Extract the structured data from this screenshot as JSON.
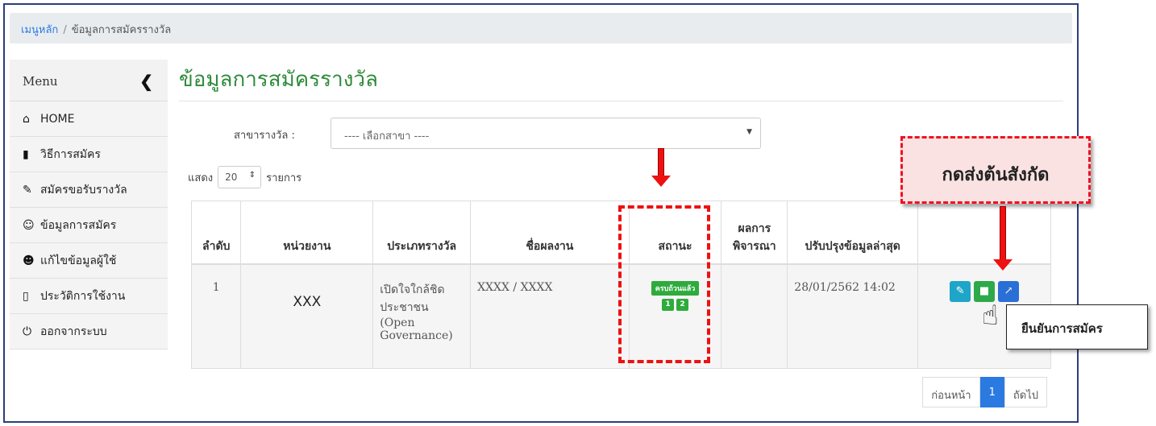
{
  "breadcrumb": {
    "home": "เมนูหลัก",
    "separator": "/",
    "current": "ข้อมูลการสมัครรางวัล"
  },
  "sidebar": {
    "title": "Menu",
    "collapse_icon": "chevron-left-icon",
    "items": [
      {
        "label": "HOME",
        "icon": "home-icon"
      },
      {
        "label": "วิธีการสมัคร",
        "icon": "file-icon"
      },
      {
        "label": "สมัครขอรับรางวัล",
        "icon": "pencil-icon"
      },
      {
        "label": "ข้อมูลการสมัคร",
        "icon": "users-icon"
      },
      {
        "label": "แก้ไขข้อมูลผู้ใช้",
        "icon": "user-icon"
      },
      {
        "label": "ประวัติการใช้งาน",
        "icon": "bookmark-icon"
      },
      {
        "label": "ออกจากระบบ",
        "icon": "power-icon"
      }
    ]
  },
  "page": {
    "title": "ข้อมูลการสมัครรางวัล"
  },
  "filter": {
    "label": "สาขารางวัล :",
    "selected": "---- เลือกสาขา ----"
  },
  "pagesize": {
    "prefix": "แสดง",
    "value": "20",
    "suffix": "รายการ"
  },
  "table": {
    "headers": [
      "ลำดับ",
      "หน่วยงาน",
      "ประเภทรางวัล",
      "ชื่อผลงาน",
      "สถานะ",
      "ผลการพิจารณา",
      "ปรับปรุงข้อมูลล่าสุด",
      ""
    ],
    "rows": [
      {
        "no": "1",
        "unit": "XXX",
        "type_line1": "เปิดใจใกล้ชิด",
        "type_line2": "ประชาชน",
        "type_line3": "(Open",
        "type_line4": "Governance)",
        "work": "XXXX / XXXX",
        "status": "ครบถ้วนแล้ว",
        "status_steps": [
          "1",
          "2"
        ],
        "result": "",
        "updated": "28/01/2562 14:02"
      }
    ]
  },
  "pager": {
    "prev": "ก่อนหน้า",
    "current": "1",
    "next": "ถัดไป"
  },
  "annotations": {
    "send_to_agency": "กดส่งต้นสังกัด",
    "confirm_application": "ยืนยันการสมัคร"
  },
  "colors": {
    "title_green": "#2e8b3a",
    "badge_green": "#2eab3c",
    "accent_red": "#e11111",
    "link_blue": "#2a7ae2"
  }
}
